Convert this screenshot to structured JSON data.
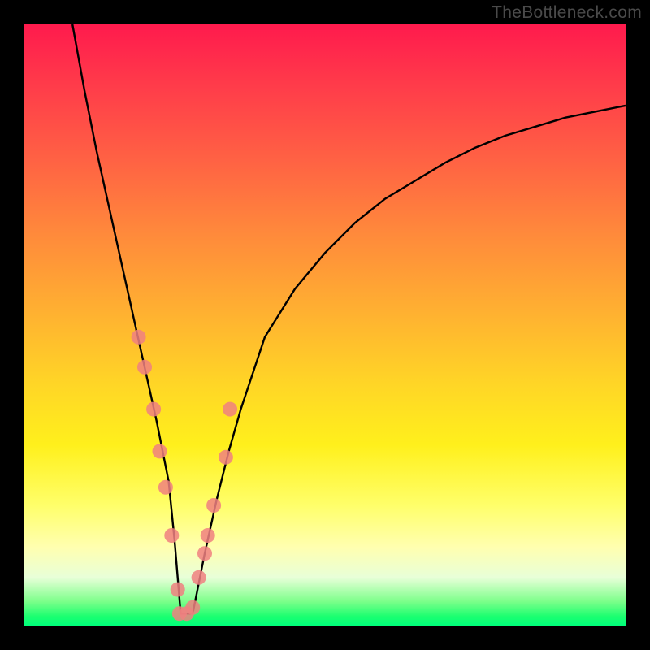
{
  "watermark": "TheBottleneck.com",
  "colors": {
    "black": "#000000",
    "curve_stroke": "#000000",
    "marker_fill": "#f08080",
    "marker_stroke": "#f08080"
  },
  "chart_data": {
    "type": "line",
    "title": "",
    "xlabel": "",
    "ylabel": "",
    "xlim": [
      0,
      100
    ],
    "ylim": [
      0,
      100
    ],
    "grid": false,
    "legend": false,
    "series": [
      {
        "name": "bottleneck-curve",
        "x": [
          8,
          10,
          12,
          14,
          16,
          18,
          20,
          22,
          24,
          25,
          26,
          28,
          30,
          32,
          34,
          36,
          38,
          40,
          45,
          50,
          55,
          60,
          65,
          70,
          75,
          80,
          85,
          90,
          95,
          100
        ],
        "y": [
          100,
          89,
          79,
          70,
          61,
          52,
          43,
          34,
          24,
          14,
          2,
          2,
          12,
          21,
          29,
          36,
          42,
          48,
          56,
          62,
          67,
          71,
          74,
          77,
          79.5,
          81.5,
          83,
          84.5,
          85.5,
          86.5
        ]
      },
      {
        "name": "sample-markers",
        "x": [
          19,
          20,
          21.5,
          22.5,
          23.5,
          24.5,
          25.5,
          25.8,
          27,
          28,
          29,
          30,
          30.5,
          31.5,
          33.5,
          34.2
        ],
        "y": [
          48,
          43,
          36,
          29,
          23,
          15,
          6,
          2,
          2,
          3,
          8,
          12,
          15,
          20,
          28,
          36
        ]
      }
    ],
    "minimum_x": 26
  }
}
